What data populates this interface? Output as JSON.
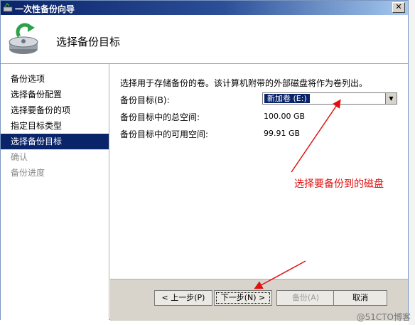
{
  "window": {
    "title": "一次性备份向导"
  },
  "header": {
    "title": "选择备份目标"
  },
  "sidebar": {
    "items": [
      {
        "label": "备份选项",
        "state": "normal"
      },
      {
        "label": "选择备份配置",
        "state": "normal"
      },
      {
        "label": "选择要备份的项",
        "state": "normal"
      },
      {
        "label": "指定目标类型",
        "state": "normal"
      },
      {
        "label": "选择备份目标",
        "state": "active"
      },
      {
        "label": "确认",
        "state": "disabled"
      },
      {
        "label": "备份进度",
        "state": "disabled"
      }
    ]
  },
  "main": {
    "description": "选择用于存储备份的卷。该计算机附带的外部磁盘将作为卷列出。",
    "backup_target_label": "备份目标(B):",
    "backup_target_value": "新加卷  (E:)",
    "total_space_label": "备份目标中的总空间:",
    "total_space_value": "100.00 GB",
    "free_space_label": "备份目标中的可用空间:",
    "free_space_value": "99.91 GB"
  },
  "buttons": {
    "previous": "< 上一步(P)",
    "next": "下一步(N) >",
    "backup": "备份(A)",
    "cancel": "取消"
  },
  "annotation": {
    "text": "选择要备份到的磁盘",
    "color": "#e01010"
  },
  "watermark": "@51CTO博客"
}
